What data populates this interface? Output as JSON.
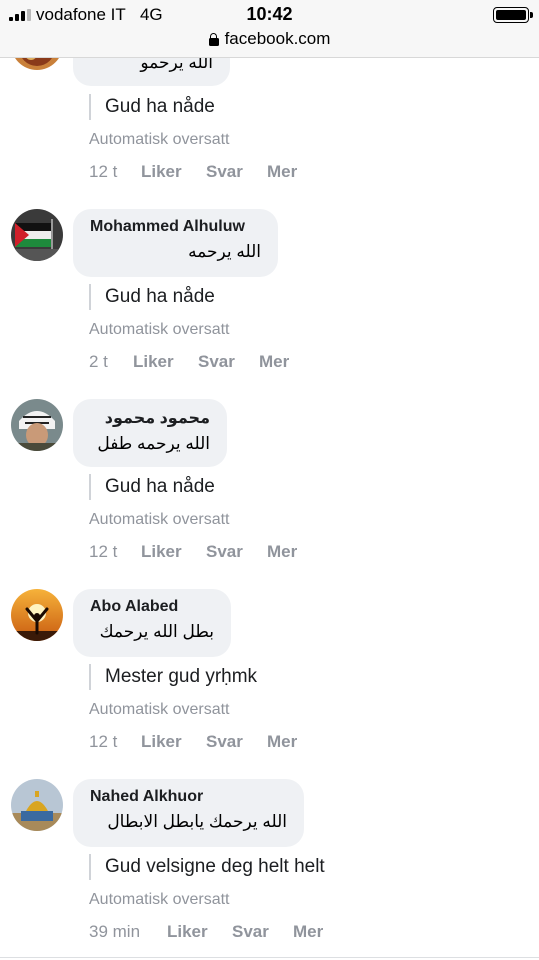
{
  "status_bar": {
    "carrier": "vodafone IT",
    "network": "4G",
    "time": "10:42",
    "battery_level": 1.0,
    "signal_bars": 4
  },
  "browser": {
    "url": "facebook.com"
  },
  "comments": [
    {
      "author": "",
      "text": "الله يرحمو",
      "translation": "Gud ha nåde",
      "auto_label": "Automatisk oversatt",
      "time": "12 t",
      "like": "Liker",
      "reply": "Svar",
      "more": "Mer"
    },
    {
      "author": "Mohammed Alhuluw",
      "text": "الله يرحمه",
      "translation": "Gud ha nåde",
      "auto_label": "Automatisk oversatt",
      "time": "2 t",
      "like": "Liker",
      "reply": "Svar",
      "more": "Mer"
    },
    {
      "author": "محمود محمود",
      "text": "الله يرحمه طفل",
      "translation": "Gud ha nåde",
      "auto_label": "Automatisk oversatt",
      "time": "12 t",
      "like": "Liker",
      "reply": "Svar",
      "more": "Mer"
    },
    {
      "author": "Abo Alabed",
      "text": "بطل الله يرحمك",
      "translation": "Mester gud yrḥmk",
      "auto_label": "Automatisk oversatt",
      "time": "12 t",
      "like": "Liker",
      "reply": "Svar",
      "more": "Mer"
    },
    {
      "author": "Nahed Alkhuor",
      "text": "الله يرحمك يابطل الابطال",
      "translation": "Gud velsigne deg helt helt",
      "auto_label": "Automatisk oversatt",
      "time": "39 min",
      "like": "Liker",
      "reply": "Svar",
      "more": "Mer"
    }
  ],
  "colors": {
    "bubble": "#eff1f4",
    "meta_text": "#90949c",
    "name_text": "#1c1e21",
    "topbar": "#f7f7f7"
  }
}
